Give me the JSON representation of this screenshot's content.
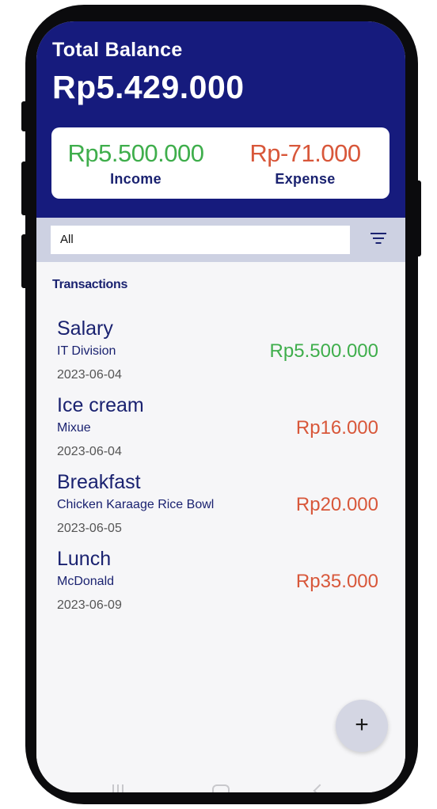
{
  "header": {
    "total_label": "Total Balance",
    "total_value": "Rp5.429.000"
  },
  "summary": {
    "income_amount": "Rp5.500.000",
    "income_label": "Income",
    "expense_amount": "Rp-71.000",
    "expense_label": "Expense"
  },
  "filter": {
    "selected": "All",
    "icon": "filter-icon"
  },
  "transactions_title": "Transactions",
  "transactions": [
    {
      "title": "Salary",
      "description": "IT Division",
      "date": "2023-06-04",
      "amount": "Rp5.500.000",
      "type": "income"
    },
    {
      "title": "Ice cream",
      "description": "Mixue",
      "date": "2023-06-04",
      "amount": "Rp16.000",
      "type": "expense"
    },
    {
      "title": "Breakfast",
      "description": "Chicken Karaage Rice Bowl",
      "date": "2023-06-05",
      "amount": "Rp20.000",
      "type": "expense"
    },
    {
      "title": "Lunch",
      "description": "McDonald",
      "date": "2023-06-09",
      "amount": "Rp35.000",
      "type": "expense"
    }
  ],
  "fab": {
    "label": "+",
    "icon": "plus-icon"
  },
  "nav": {
    "icons": [
      "recent-apps-icon",
      "home-icon",
      "back-icon"
    ]
  },
  "colors": {
    "header_bg": "#161b7d",
    "income": "#3fae4c",
    "expense": "#d8573a",
    "text_primary": "#1a2270",
    "filter_bar": "#cdd1e2"
  }
}
